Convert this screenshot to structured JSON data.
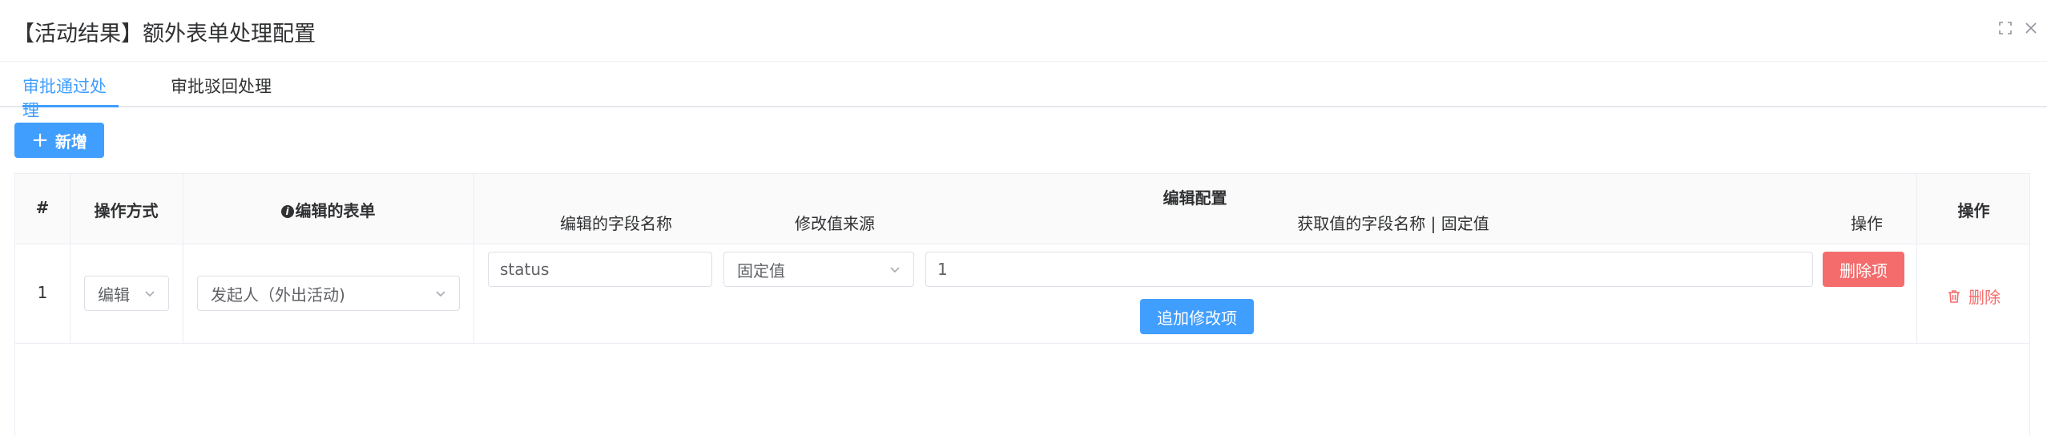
{
  "dialog": {
    "title": "【活动结果】额外表单处理配置",
    "icons": {
      "fullscreen": "fullscreen-icon",
      "close": "close-icon"
    }
  },
  "tabs": [
    {
      "label": "审批通过处理",
      "active": true
    },
    {
      "label": "审批驳回处理",
      "active": false
    }
  ],
  "toolbar": {
    "add_label": "新增",
    "add_icon": "plus-icon"
  },
  "table": {
    "headers": {
      "index": "#",
      "operation_mode": "操作方式",
      "edit_form": "编辑的表单",
      "edit_config": "编辑配置",
      "actions": "操作"
    },
    "sub_headers": {
      "field_name": "编辑的字段名称",
      "value_source": "修改值来源",
      "value_field": "获取值的字段名称 | 固定值",
      "sub_actions": "操作"
    },
    "rows": [
      {
        "index": "1",
        "operation_mode": "编辑",
        "edit_form": "发起人（外出活动)",
        "config_items": [
          {
            "field_name": "status",
            "value_source": "固定值",
            "value": "1",
            "delete_label": "删除项"
          }
        ],
        "add_item_label": "追加修改项",
        "delete_label": "删除"
      }
    ]
  },
  "colors": {
    "primary": "#409eff",
    "danger": "#f56c6c",
    "border": "#ebeef5"
  }
}
